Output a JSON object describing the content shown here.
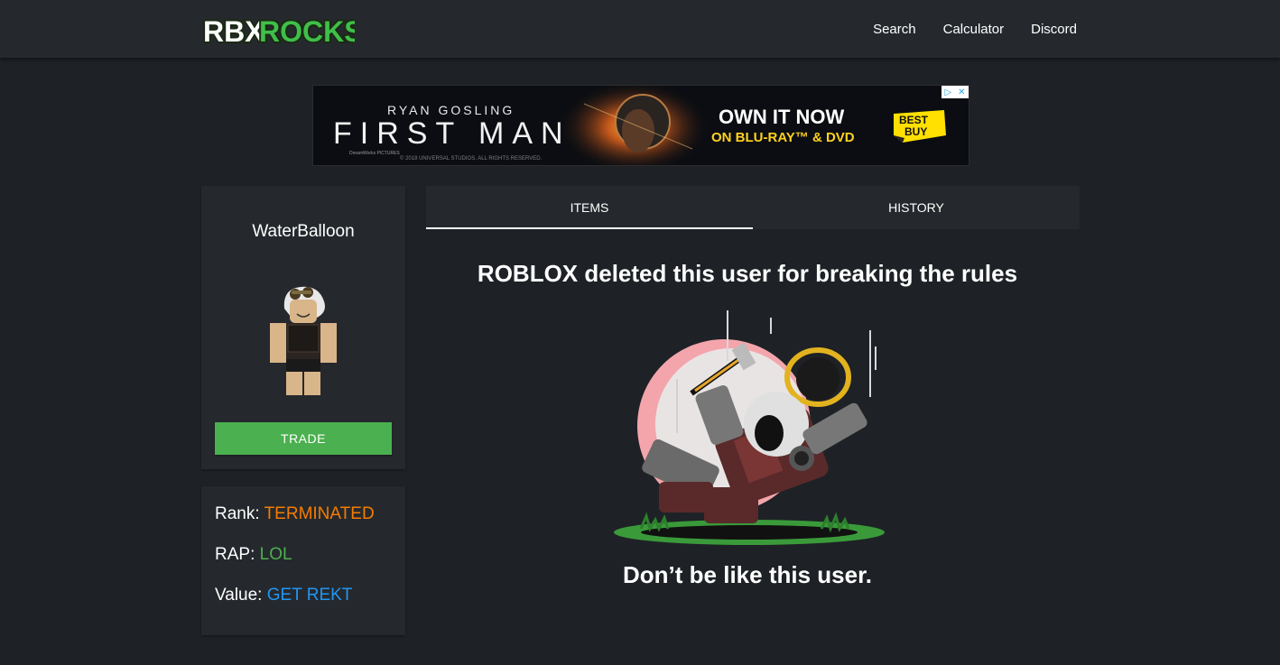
{
  "navbar": {
    "logo_text_part1": "RBX",
    "logo_text_part2": "ROCKS",
    "links": [
      "Search",
      "Calculator",
      "Discord"
    ]
  },
  "ad": {
    "line1": "RYAN GOSLING",
    "line2": "FIRST MAN",
    "cta1": "OWN IT NOW",
    "cta2": "ON BLU-RAY™ & DVD",
    "brand": "BEST BUY",
    "copyright": "© 2018 UNIVERSAL STUDIOS. ALL RIGHTS RESERVED.",
    "studio": "DreamWorks PICTURES"
  },
  "profile": {
    "username": "WaterBalloon",
    "trade_label": "TRADE"
  },
  "stats": {
    "rank_label": "Rank:",
    "rank_value": "TERMINATED",
    "rap_label": "RAP:",
    "rap_value": "LOL",
    "value_label": "Value:",
    "value_value": "GET REKT"
  },
  "tabs": [
    "ITEMS",
    "HISTORY"
  ],
  "main": {
    "headline": "ROBLOX deleted this user for breaking the rules",
    "subline": "Don’t be like this user."
  },
  "colors": {
    "accent_green": "#4bb04f",
    "rank_orange": "#f57c00",
    "rap_green": "#4caf50",
    "value_blue": "#2196f3",
    "background": "#1e2226",
    "card": "#25292d"
  }
}
